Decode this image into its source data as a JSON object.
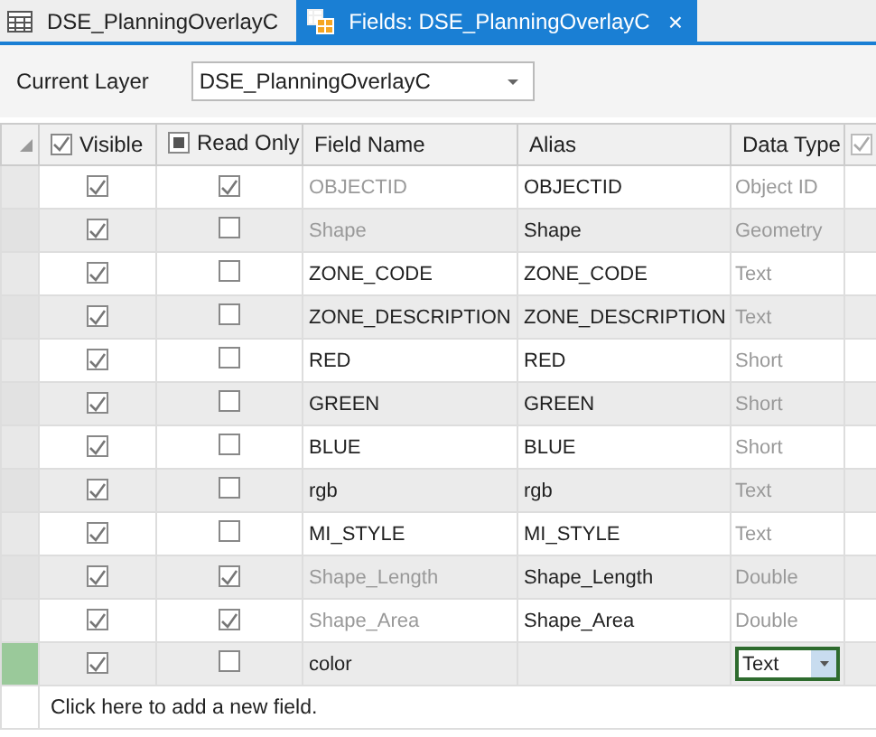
{
  "tabs": [
    {
      "label": "DSE_PlanningOverlayC",
      "kind": "table",
      "selected": false
    },
    {
      "label": "Fields:  DSE_PlanningOverlayC",
      "kind": "fields",
      "selected": true,
      "close": "×"
    }
  ],
  "current_layer": {
    "label": "Current Layer",
    "value": "DSE_PlanningOverlayC"
  },
  "table": {
    "columns": [
      {
        "label": "Visible",
        "kind": "check",
        "checked": true
      },
      {
        "label": "Read Only",
        "kind": "check",
        "checked": false,
        "partial": true
      },
      {
        "label": "Field Name",
        "kind": "text"
      },
      {
        "label": "Alias",
        "kind": "text"
      },
      {
        "label": "Data Type",
        "kind": "text"
      },
      {
        "kind": "check",
        "checked": true,
        "disabled": true
      }
    ],
    "rows": [
      {
        "visible": true,
        "read_only": true,
        "field_name": "OBJECTID",
        "name_disabled": true,
        "alias": "OBJECTID",
        "data_type": "Object ID",
        "selected": false,
        "editing": false
      },
      {
        "visible": true,
        "read_only": false,
        "field_name": "Shape",
        "name_disabled": true,
        "alias": "Shape",
        "data_type": "Geometry",
        "selected": false,
        "editing": false
      },
      {
        "visible": true,
        "read_only": false,
        "field_name": "ZONE_CODE",
        "name_disabled": false,
        "alias": "ZONE_CODE",
        "data_type": "Text",
        "selected": false,
        "editing": false
      },
      {
        "visible": true,
        "read_only": false,
        "field_name": "ZONE_DESCRIPTION",
        "name_disabled": false,
        "alias": "ZONE_DESCRIPTION",
        "data_type": "Text",
        "selected": false,
        "editing": false
      },
      {
        "visible": true,
        "read_only": false,
        "field_name": "RED",
        "name_disabled": false,
        "alias": "RED",
        "data_type": "Short",
        "selected": false,
        "editing": false
      },
      {
        "visible": true,
        "read_only": false,
        "field_name": "GREEN",
        "name_disabled": false,
        "alias": "GREEN",
        "data_type": "Short",
        "selected": false,
        "editing": false
      },
      {
        "visible": true,
        "read_only": false,
        "field_name": "BLUE",
        "name_disabled": false,
        "alias": "BLUE",
        "data_type": "Short",
        "selected": false,
        "editing": false
      },
      {
        "visible": true,
        "read_only": false,
        "field_name": "rgb",
        "name_disabled": false,
        "alias": "rgb",
        "data_type": "Text",
        "selected": false,
        "editing": false
      },
      {
        "visible": true,
        "read_only": false,
        "field_name": "MI_STYLE",
        "name_disabled": false,
        "alias": "MI_STYLE",
        "data_type": "Text",
        "selected": false,
        "editing": false
      },
      {
        "visible": true,
        "read_only": true,
        "field_name": "Shape_Length",
        "name_disabled": true,
        "alias": "Shape_Length",
        "data_type": "Double",
        "selected": false,
        "editing": false
      },
      {
        "visible": true,
        "read_only": true,
        "field_name": "Shape_Area",
        "name_disabled": true,
        "alias": "Shape_Area",
        "data_type": "Double",
        "selected": false,
        "editing": false
      },
      {
        "visible": true,
        "read_only": false,
        "field_name": "color",
        "name_disabled": false,
        "data_type": "Text",
        "selected": true,
        "editing": true
      }
    ],
    "add_row": "Click here to add a new field."
  }
}
